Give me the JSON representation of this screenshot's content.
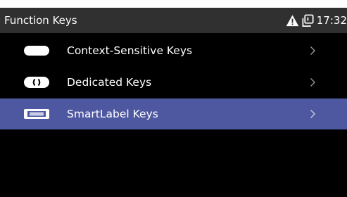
{
  "header": {
    "title": "Function Keys",
    "time": "17:32",
    "status_icons": [
      "warning-icon",
      "copy-icon"
    ]
  },
  "menu": {
    "items": [
      {
        "label": "Context-Sensitive Keys",
        "icon": "oval-key-icon",
        "selected": false
      },
      {
        "label": "Dedicated Keys",
        "icon": "dedicated-key-icon",
        "selected": false
      },
      {
        "label": "SmartLabel Keys",
        "icon": "smartlabel-key-icon",
        "selected": true
      }
    ]
  },
  "colors": {
    "background": "#000000",
    "header": "#303030",
    "selection": "#4e58a0",
    "text": "#ffffff",
    "chevron": "#9a9a9a"
  }
}
